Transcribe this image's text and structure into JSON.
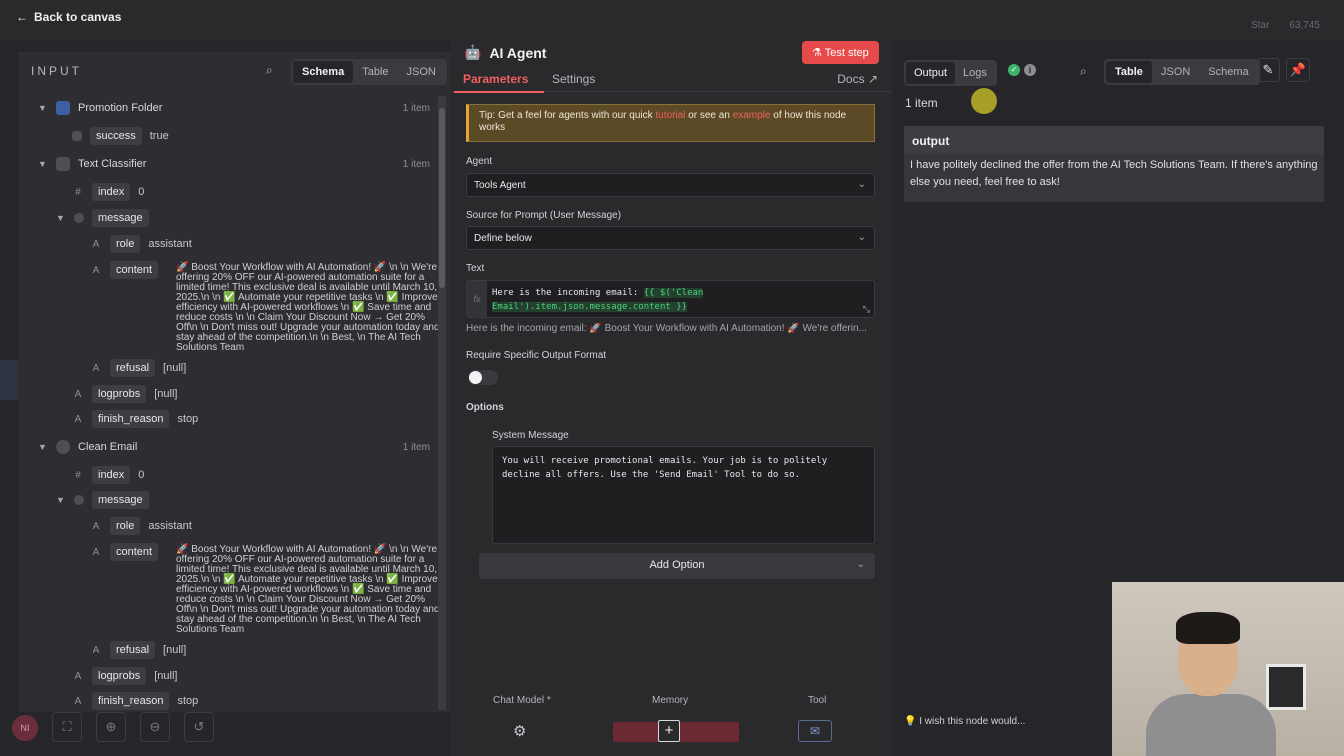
{
  "topbar": {
    "back_label": "Back to canvas",
    "star_label": "Star",
    "star_count": "63,745"
  },
  "input": {
    "title": "INPUT",
    "view_tabs": [
      "Schema",
      "Table",
      "JSON"
    ],
    "nodes": {
      "promotion_folder": {
        "name": "Promotion Folder",
        "count": "1 item"
      },
      "text_classifier": {
        "name": "Text Classifier",
        "count": "1 item"
      },
      "clean_email": {
        "name": "Clean Email",
        "count": "1 item"
      }
    },
    "fields": {
      "success": "success",
      "success_val": "true",
      "index": "index",
      "index_val": "0",
      "message": "message",
      "role": "role",
      "role_val": "assistant",
      "content": "content",
      "refusal": "refusal",
      "null_val": "[null]",
      "logprobs": "logprobs",
      "finish_reason": "finish_reason",
      "finish_val": "stop"
    },
    "content_text_1": "🚀 Boost Your Workflow with AI Automation! 🚀 \\n \\n We're offering 20% OFF our AI-powered automation suite for a limited time! This exclusive deal is available until March 10, 2025.\\n \\n ✅ Automate your repetitive tasks \\n ✅ Improve efficiency with AI-powered workflows \\n ✅ Save time and reduce costs \\n \\n Claim Your Discount Now → Get 20% Off\\n \\n Don't miss out! Upgrade your automation today and stay ahead of the competition.\\n \\n Best, \\n The AI Tech Solutions Team",
    "content_text_2": "🚀 Boost Your Workflow with AI Automation! 🚀 \\n \\n We're offering 20% OFF our AI-powered automation suite for a limited time! This exclusive deal is available until March 10, 2025.\\n \\n ✅ Automate your repetitive tasks \\n ✅ Improve efficiency with AI-powered workflows \\n ✅ Save time and reduce costs \\n \\n Claim Your Discount Now → Get 20% Off\\n \\n Don't miss out! Upgrade your automation today and stay ahead of the competition.\\n \\n Best, \\n The AI Tech Solutions Team"
  },
  "agent": {
    "title": "AI Agent",
    "test_step": "Test step",
    "tabs": {
      "parameters": "Parameters",
      "settings": "Settings",
      "docs": "Docs"
    },
    "tip_prefix": "Tip: Get a feel for agents with our quick ",
    "tip_link1": "tutorial",
    "tip_mid": " or see an ",
    "tip_link2": "example",
    "tip_suffix": " of how this node works",
    "agent_label": "Agent",
    "agent_value": "Tools Agent",
    "source_label": "Source for Prompt (User Message)",
    "source_value": "Define below",
    "text_label": "Text",
    "text_prefix": "Here is the incoming email: ",
    "text_expr": "{{ $('Clean Email').item.json.message.content }}",
    "text_preview": "Here is the incoming email: 🚀 Boost Your Workflow with AI Automation! 🚀 We're offerin...",
    "require_label": "Require Specific Output Format",
    "options_label": "Options",
    "system_label": "System Message",
    "system_value": "You will receive promotional emails. Your job is to politely decline all offers. Use the 'Send Email' Tool to do so.",
    "add_option": "Add Option",
    "sub_chat_model": "Chat Model *",
    "sub_memory": "Memory",
    "sub_tool": "Tool"
  },
  "output": {
    "tabs": [
      "Output",
      "Logs"
    ],
    "view_tabs": [
      "Table",
      "JSON",
      "Schema"
    ],
    "item_count": "1 item",
    "column": "output",
    "value": "I have politely declined the offer from the AI Tech Solutions Team. If there's anything else you need, feel free to ask!",
    "feedback": "I wish this node would..."
  }
}
